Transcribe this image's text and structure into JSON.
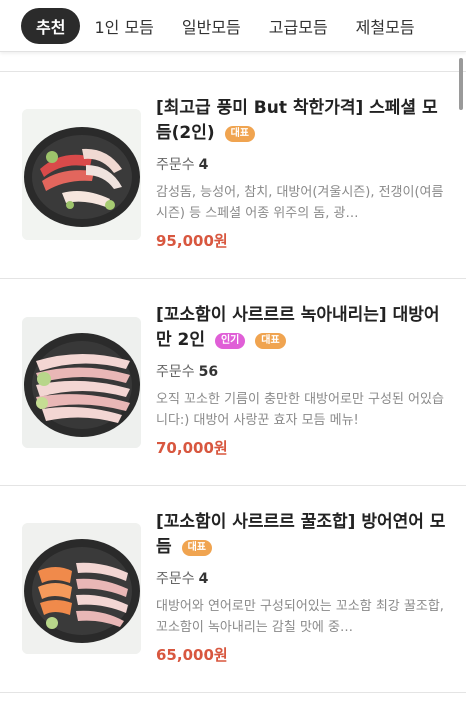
{
  "tabs": [
    {
      "label": "추천",
      "active": true
    },
    {
      "label": "1인 모듬",
      "active": false
    },
    {
      "label": "일반모듬",
      "active": false
    },
    {
      "label": "고급모듬",
      "active": false
    },
    {
      "label": "제철모듬",
      "active": false
    }
  ],
  "badges": {
    "rep": "대표",
    "pop": "인기"
  },
  "colors": {
    "price": "#d8573f",
    "badge_rep": "#f0a450",
    "badge_pop": "#e05fd7",
    "active_tab": "#2b2b2b"
  },
  "menu": [
    {
      "title": "[최고급 풍미 But 착한가격] 스페셜 모듬(2인)",
      "orders_label": "주문수",
      "orders": "4",
      "desc": "감성돔, 능성어, 참치, 대방어(겨울시즌), 전갱이(여름시즌) 등 스페셜 어종 위주의 돔, 광…",
      "price": "95,000원",
      "image": "sashimi-platter-image"
    },
    {
      "title": "[꼬소함이 사르르르 녹아내리는] 대방어만 2인",
      "orders_label": "주문수",
      "orders": "56",
      "desc": "오직 꼬소한 기름이 충만한 대방어로만 구성된 어있습니다:) 대방어 사랑꾼 효자 모듬 메뉴!",
      "price": "70,000원",
      "image": "yellowtail-platter-image"
    },
    {
      "title": "[꼬소함이 사르르르 꿀조합] 방어연어 모듬",
      "orders_label": "주문수",
      "orders": "4",
      "desc": "대방어와 연어로만 구성되어있는 꼬소함 최강 꿀조합, 꼬소함이 녹아내리는 감칠 맛에 중…",
      "price": "65,000원",
      "image": "yellowtail-salmon-platter-image"
    }
  ]
}
